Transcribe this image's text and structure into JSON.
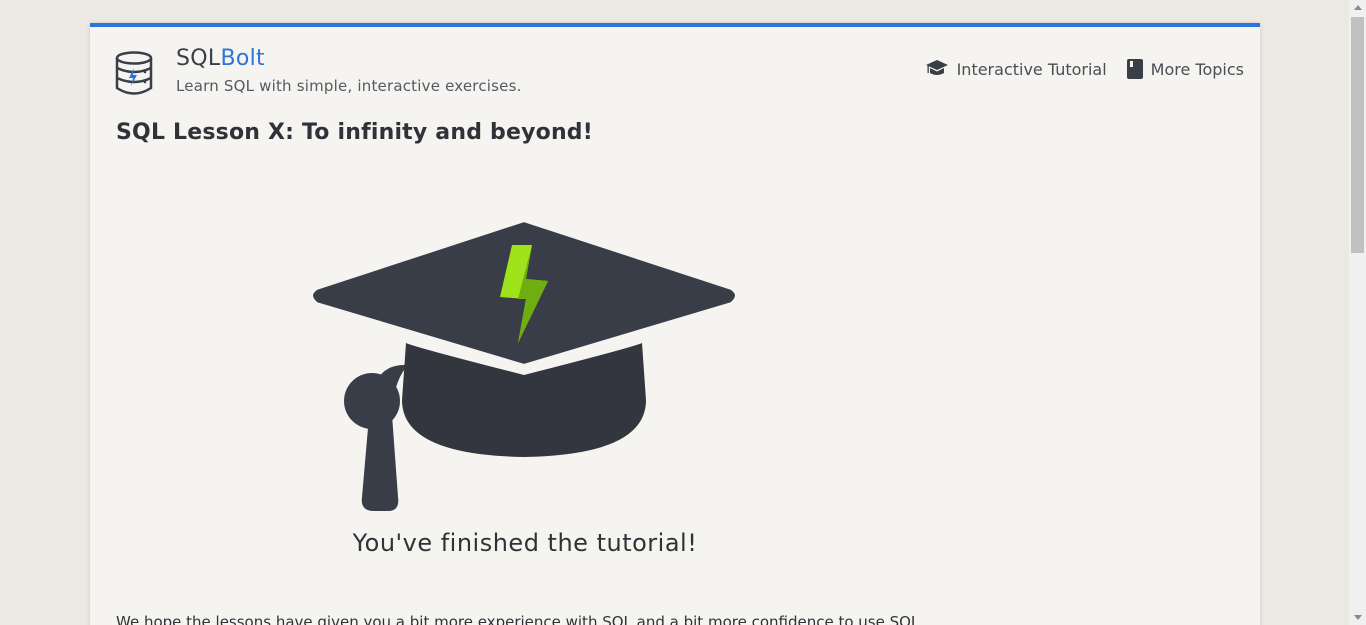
{
  "header": {
    "brand_prefix": "SQL",
    "brand_suffix": "Bolt",
    "tagline": "Learn SQL with simple, interactive exercises."
  },
  "nav": {
    "items": [
      {
        "label": "Interactive Tutorial",
        "icon": "graduation-cap-icon"
      },
      {
        "label": "More Topics",
        "icon": "book-icon"
      }
    ]
  },
  "lesson": {
    "title": "SQL Lesson X: To infinity and beyond!",
    "illustration": "graduation-cap-with-bolt",
    "caption": "You've finished the tutorial!",
    "body": "We hope the lessons have given you a bit more experience with SQL and a bit more confidence to use SQL"
  },
  "colors": {
    "accent": "#2d74da",
    "cap": "#393d47",
    "bolt": "#9fe31a",
    "bolt_shade": "#6fae10"
  }
}
